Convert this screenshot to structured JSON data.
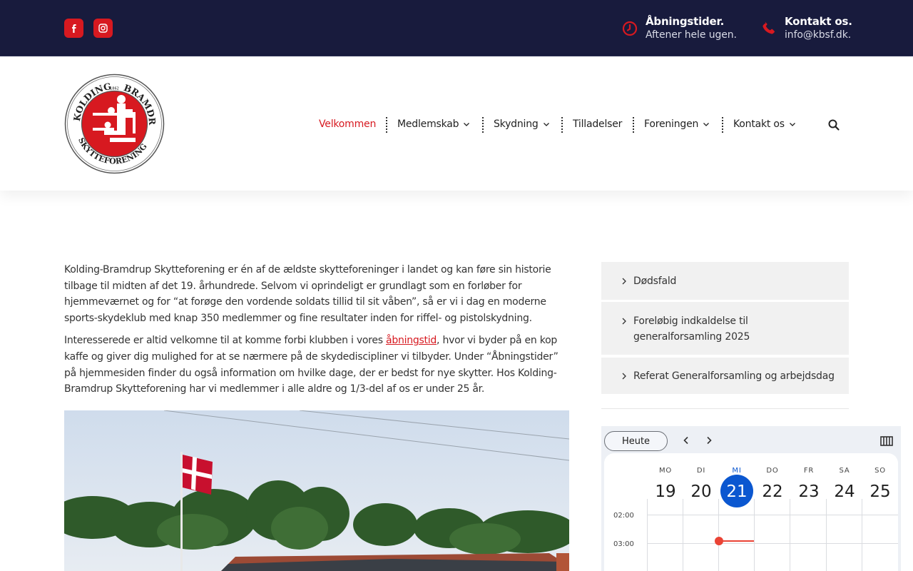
{
  "topbar": {
    "social": [
      {
        "name": "facebook-icon"
      },
      {
        "name": "instagram-icon"
      }
    ],
    "hours": {
      "title": "Åbningstider.",
      "text": "Aftener hele ugen."
    },
    "contact": {
      "title": "Kontakt os.",
      "text": "info@kbsf.dk."
    }
  },
  "nav": {
    "items": [
      {
        "label": "Velkommen",
        "active": true
      },
      {
        "label": "Medlemskab"
      },
      {
        "label": "Skydning"
      },
      {
        "label": "Tilladelser"
      },
      {
        "label": "Foreningen"
      },
      {
        "label": "Kontakt os"
      }
    ]
  },
  "logo": {
    "top_text": "KOLDING",
    "top_text2": "BRAMDRUP",
    "year": "1862",
    "bottom_text": "SKYTTEFORENING"
  },
  "content": {
    "p1": "Kolding-Bramdrup Skytteforening er én af de ældste skytteforeninger i landet og kan føre sin historie tilbage til midten af det 19. århundrede. Selvom vi oprindeligt er grundlagt som en forløber for hjemmeværnet og for “at forøge den vordende soldats tillid til sit våben”, så er vi i dag en moderne sports-skydeklub med knap 350 medlemmer og fine resultater inden for riffel- og pistolskydning.",
    "p2_before": "Interesserede er altid velkomne til at komme forbi klubben i vores ",
    "p2_link": "åbningstid",
    "p2_after": ", hvor vi byder på en kop kaffe og giver dig mulighed for at se nærmere på de skydediscipliner vi tilbyder. Under “Åbningstider” på hjemmesiden finder du også information om hvilke dage, der er bedst for nye skytter. Hos Kolding-Bramdrup Skytteforening har vi medlemmer i alle aldre og 1/3-del af os er under 25 år."
  },
  "sidebar": {
    "posts": [
      {
        "line1": "Dødsfald"
      },
      {
        "line1": "Foreløbig indkaldelse til",
        "line2": "generalforsamling 2025"
      },
      {
        "line1": "Referat Generalforsamling og arbejdsdag"
      }
    ]
  },
  "calendar": {
    "today_label": "Heute",
    "days": [
      {
        "name": "MO",
        "num": "19"
      },
      {
        "name": "DI",
        "num": "20"
      },
      {
        "name": "MI",
        "num": "21",
        "today": true
      },
      {
        "name": "DO",
        "num": "22"
      },
      {
        "name": "FR",
        "num": "23"
      },
      {
        "name": "SA",
        "num": "24"
      },
      {
        "name": "SO",
        "num": "25"
      }
    ],
    "times": [
      "02:00",
      "03:00"
    ],
    "accent": "#0b57d0",
    "now_color": "#ea4335"
  },
  "colors": {
    "brand_red": "#d71920",
    "topbar_bg": "#181b3d"
  }
}
